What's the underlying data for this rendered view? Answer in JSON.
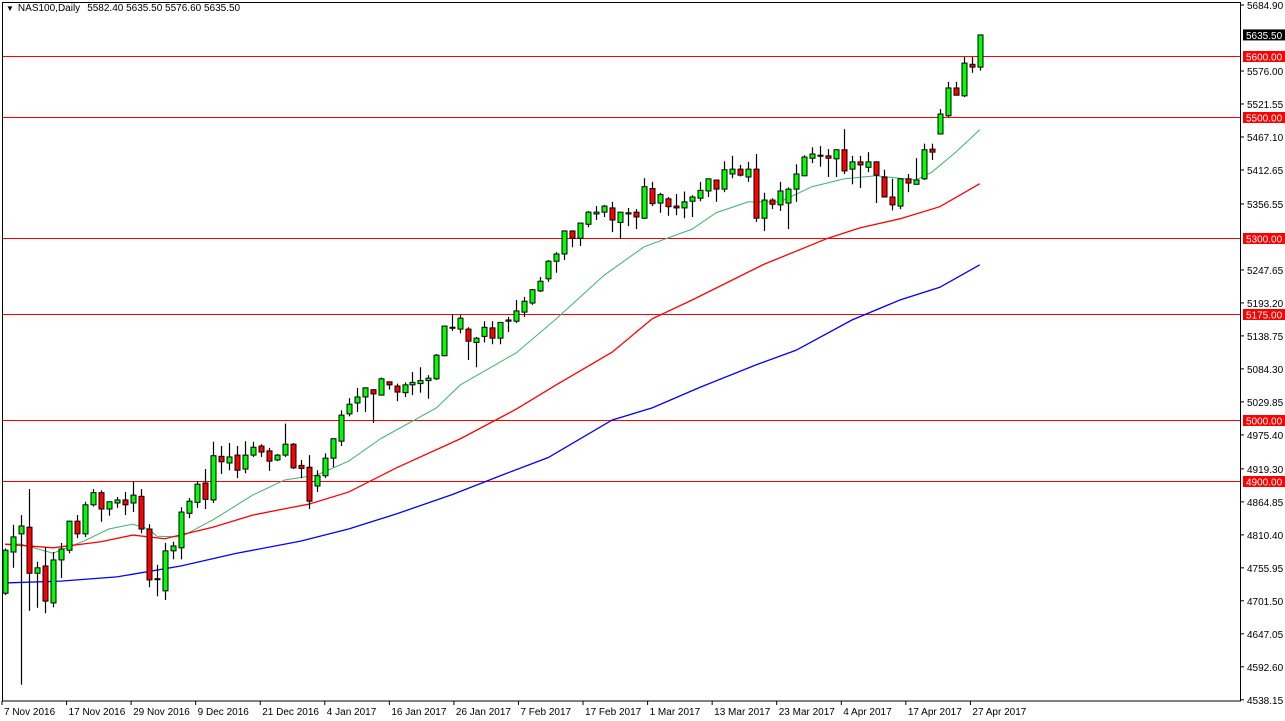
{
  "header": {
    "symbol_timeframe": "NAS100,Daily",
    "ohlc_readout": "5582.40 5635.50 5576.60 5635.50",
    "menu_icon": "triangle-down-icon"
  },
  "colors": {
    "bull": "#00ff00",
    "bear": "#ff0000",
    "outline": "#000000",
    "level_line": "#ff0000",
    "ma_fast": "#3cb371",
    "ma_mid": "#ff0000",
    "ma_slow": "#0000ff",
    "price_tag": "#000000"
  },
  "chart_data": {
    "type": "candlestick",
    "title": "NAS100,Daily",
    "ylim": [
      4538.15,
      5684.9
    ],
    "y_ticks": [
      "5684.90",
      "5576.00",
      "5521.55",
      "5467.10",
      "5412.65",
      "5356.55",
      "5247.65",
      "5193.20",
      "5138.75",
      "5084.30",
      "5029.85",
      "4975.40",
      "4919.30",
      "4864.85",
      "4810.40",
      "4755.95",
      "4701.50",
      "4647.05",
      "4592.60",
      "4538.15"
    ],
    "x_tick_labels": [
      "7 Nov 2016",
      "17 Nov 2016",
      "29 Nov 2016",
      "9 Dec 2016",
      "21 Dec 2016",
      "4 Jan 2017",
      "16 Jan 2017",
      "26 Jan 2017",
      "7 Feb 2017",
      "17 Feb 2017",
      "1 Mar 2017",
      "13 Mar 2017",
      "23 Mar 2017",
      "4 Apr 2017",
      "17 Apr 2017",
      "27 Apr 2017"
    ],
    "x_tick_bar_step": 8,
    "current_price": "5635.50",
    "levels": [
      "5600.00",
      "5500.00",
      "5300.00",
      "5175.00",
      "5000.00",
      "4900.00"
    ],
    "ohlc_fields": [
      "open",
      "high",
      "low",
      "close"
    ],
    "ohlc": [
      [
        4714,
        4788,
        4711,
        4785
      ],
      [
        4782,
        4827,
        4756,
        4807
      ],
      [
        4812,
        4843,
        4563,
        4825
      ],
      [
        4823,
        4886,
        4685,
        4747
      ],
      [
        4747,
        4766,
        4690,
        4756
      ],
      [
        4759,
        4790,
        4681,
        4701
      ],
      [
        4698,
        4782,
        4691,
        4769
      ],
      [
        4769,
        4797,
        4739,
        4787
      ],
      [
        4785,
        4833,
        4780,
        4833
      ],
      [
        4833,
        4843,
        4805,
        4812
      ],
      [
        4812,
        4865,
        4807,
        4860
      ],
      [
        4860,
        4886,
        4857,
        4880
      ],
      [
        4880,
        4884,
        4832,
        4853
      ],
      [
        4853,
        4865,
        4842,
        4865
      ],
      [
        4863,
        4873,
        4855,
        4868
      ],
      [
        4868,
        4881,
        4843,
        4860
      ],
      [
        4863,
        4899,
        4848,
        4876
      ],
      [
        4874,
        4886,
        4813,
        4820
      ],
      [
        4820,
        4828,
        4724,
        4736
      ],
      [
        4737,
        4761,
        4709,
        4738
      ],
      [
        4718,
        4797,
        4703,
        4784
      ],
      [
        4784,
        4799,
        4770,
        4792
      ],
      [
        4789,
        4856,
        4770,
        4848
      ],
      [
        4846,
        4871,
        4838,
        4866
      ],
      [
        4864,
        4899,
        4855,
        4894
      ],
      [
        4896,
        4919,
        4853,
        4869
      ],
      [
        4868,
        4964,
        4863,
        4941
      ],
      [
        4940,
        4957,
        4911,
        4931
      ],
      [
        4929,
        4962,
        4917,
        4939
      ],
      [
        4942,
        4957,
        4904,
        4917
      ],
      [
        4919,
        4965,
        4912,
        4942
      ],
      [
        4942,
        4964,
        4939,
        4955
      ],
      [
        4957,
        4960,
        4939,
        4947
      ],
      [
        4949,
        4954,
        4916,
        4932
      ],
      [
        4934,
        4944,
        4932,
        4942
      ],
      [
        4942,
        4994,
        4939,
        4960
      ],
      [
        4960,
        4962,
        4919,
        4921
      ],
      [
        4925,
        4934,
        4904,
        4920
      ],
      [
        4922,
        4942,
        4853,
        4866
      ],
      [
        4891,
        4917,
        4881,
        4908
      ],
      [
        4908,
        4945,
        4904,
        4937
      ],
      [
        4937,
        4970,
        4922,
        4969
      ],
      [
        4965,
        5016,
        4957,
        5008
      ],
      [
        5010,
        5036,
        5006,
        5026
      ],
      [
        5028,
        5053,
        5013,
        5038
      ],
      [
        5038,
        5054,
        5013,
        5053
      ],
      [
        5050,
        5050,
        4995,
        5043
      ],
      [
        5041,
        5070,
        5041,
        5068
      ],
      [
        5063,
        5063,
        5050,
        5058
      ],
      [
        5056,
        5060,
        5031,
        5046
      ],
      [
        5045,
        5062,
        5038,
        5058
      ],
      [
        5058,
        5079,
        5041,
        5062
      ],
      [
        5060,
        5087,
        5045,
        5065
      ],
      [
        5065,
        5074,
        5035,
        5069
      ],
      [
        5068,
        5109,
        5066,
        5107
      ],
      [
        5106,
        5155,
        5105,
        5155
      ],
      [
        5152,
        5175,
        5147,
        5153
      ],
      [
        5150,
        5173,
        5143,
        5168
      ],
      [
        5150,
        5153,
        5099,
        5130
      ],
      [
        5128,
        5137,
        5087,
        5135
      ],
      [
        5138,
        5163,
        5128,
        5153
      ],
      [
        5152,
        5163,
        5125,
        5135
      ],
      [
        5135,
        5161,
        5125,
        5161
      ],
      [
        5163,
        5170,
        5145,
        5165
      ],
      [
        5163,
        5198,
        5160,
        5180
      ],
      [
        5178,
        5203,
        5170,
        5196
      ],
      [
        5193,
        5216,
        5190,
        5215
      ],
      [
        5213,
        5236,
        5211,
        5229
      ],
      [
        5233,
        5264,
        5228,
        5262
      ],
      [
        5262,
        5277,
        5243,
        5274
      ],
      [
        5274,
        5313,
        5264,
        5312
      ],
      [
        5312,
        5313,
        5285,
        5300
      ],
      [
        5300,
        5325,
        5287,
        5325
      ],
      [
        5323,
        5345,
        5318,
        5343
      ],
      [
        5340,
        5353,
        5330,
        5343
      ],
      [
        5343,
        5355,
        5335,
        5353
      ],
      [
        5350,
        5360,
        5310,
        5330
      ],
      [
        5326,
        5343,
        5299,
        5343
      ],
      [
        5340,
        5350,
        5320,
        5342
      ],
      [
        5343,
        5348,
        5315,
        5335
      ],
      [
        5333,
        5399,
        5332,
        5385
      ],
      [
        5382,
        5393,
        5353,
        5357
      ],
      [
        5358,
        5375,
        5342,
        5372
      ],
      [
        5365,
        5368,
        5337,
        5352
      ],
      [
        5353,
        5373,
        5338,
        5350
      ],
      [
        5350,
        5377,
        5333,
        5360
      ],
      [
        5361,
        5371,
        5335,
        5368
      ],
      [
        5366,
        5393,
        5361,
        5379
      ],
      [
        5378,
        5398,
        5368,
        5398
      ],
      [
        5396,
        5396,
        5360,
        5381
      ],
      [
        5381,
        5427,
        5376,
        5413
      ],
      [
        5406,
        5436,
        5399,
        5414
      ],
      [
        5414,
        5421,
        5402,
        5404
      ],
      [
        5401,
        5426,
        5393,
        5414
      ],
      [
        5414,
        5439,
        5327,
        5333
      ],
      [
        5333,
        5375,
        5312,
        5363
      ],
      [
        5363,
        5366,
        5348,
        5356
      ],
      [
        5355,
        5393,
        5345,
        5378
      ],
      [
        5358,
        5384,
        5315,
        5381
      ],
      [
        5381,
        5422,
        5360,
        5406
      ],
      [
        5403,
        5437,
        5403,
        5434
      ],
      [
        5432,
        5450,
        5424,
        5439
      ],
      [
        5436,
        5452,
        5418,
        5437
      ],
      [
        5436,
        5447,
        5401,
        5432
      ],
      [
        5431,
        5446,
        5401,
        5446
      ],
      [
        5446,
        5480,
        5406,
        5411
      ],
      [
        5414,
        5436,
        5389,
        5426
      ],
      [
        5426,
        5436,
        5383,
        5421
      ],
      [
        5417,
        5442,
        5409,
        5426
      ],
      [
        5426,
        5427,
        5358,
        5404
      ],
      [
        5401,
        5413,
        5368,
        5368
      ],
      [
        5368,
        5398,
        5346,
        5355
      ],
      [
        5353,
        5398,
        5348,
        5398
      ],
      [
        5398,
        5406,
        5376,
        5391
      ],
      [
        5389,
        5432,
        5389,
        5396
      ],
      [
        5398,
        5456,
        5396,
        5446
      ],
      [
        5447,
        5456,
        5429,
        5442
      ],
      [
        5472,
        5513,
        5472,
        5505
      ],
      [
        5502,
        5558,
        5500,
        5548
      ],
      [
        5548,
        5558,
        5536,
        5536
      ],
      [
        5535,
        5599,
        5533,
        5589
      ],
      [
        5587,
        5599,
        5573,
        5582.4
      ],
      [
        5582.4,
        5635.5,
        5576.6,
        5635.5
      ]
    ],
    "moving_averages": [
      {
        "name": "ma-fast",
        "color": "#3cb371",
        "points": [
          [
            0,
            4795
          ],
          [
            2,
            4795
          ],
          [
            6,
            4780
          ],
          [
            10,
            4801
          ],
          [
            13,
            4820
          ],
          [
            16,
            4828
          ],
          [
            18,
            4820
          ],
          [
            19,
            4808
          ],
          [
            22,
            4807
          ],
          [
            26,
            4835
          ],
          [
            31,
            4876
          ],
          [
            35,
            4901
          ],
          [
            39,
            4909
          ],
          [
            43,
            4932
          ],
          [
            47,
            4969
          ],
          [
            54,
            5020
          ],
          [
            57,
            5058
          ],
          [
            64,
            5111
          ],
          [
            69,
            5167
          ],
          [
            75,
            5239
          ],
          [
            80,
            5286
          ],
          [
            86,
            5315
          ],
          [
            89,
            5342
          ],
          [
            93,
            5360
          ],
          [
            97,
            5360
          ],
          [
            101,
            5385
          ],
          [
            105,
            5398
          ],
          [
            109,
            5403
          ],
          [
            114,
            5396
          ],
          [
            116,
            5409
          ],
          [
            119,
            5442
          ],
          [
            122,
            5479
          ]
        ]
      },
      {
        "name": "ma-mid",
        "color": "#ff0000",
        "points": [
          [
            0,
            4795
          ],
          [
            6,
            4789
          ],
          [
            12,
            4799
          ],
          [
            16,
            4810
          ],
          [
            20,
            4804
          ],
          [
            26,
            4823
          ],
          [
            31,
            4843
          ],
          [
            36,
            4856
          ],
          [
            38,
            4861
          ],
          [
            43,
            4881
          ],
          [
            49,
            4921
          ],
          [
            57,
            4969
          ],
          [
            64,
            5018
          ],
          [
            69,
            5058
          ],
          [
            76,
            5112
          ],
          [
            81,
            5167
          ],
          [
            86,
            5198
          ],
          [
            95,
            5257
          ],
          [
            103,
            5300
          ],
          [
            107,
            5317
          ],
          [
            112,
            5332
          ],
          [
            117,
            5352
          ],
          [
            122,
            5390
          ]
        ]
      },
      {
        "name": "ma-slow",
        "color": "#0000ff",
        "points": [
          [
            0,
            4731
          ],
          [
            7,
            4734
          ],
          [
            14,
            4741
          ],
          [
            22,
            4759
          ],
          [
            29,
            4780
          ],
          [
            37,
            4800
          ],
          [
            43,
            4820
          ],
          [
            49,
            4845
          ],
          [
            56,
            4877
          ],
          [
            62,
            4908
          ],
          [
            68,
            4938
          ],
          [
            76,
            5000
          ],
          [
            81,
            5020
          ],
          [
            87,
            5054
          ],
          [
            94,
            5091
          ],
          [
            99,
            5115
          ],
          [
            106,
            5165
          ],
          [
            112,
            5198
          ],
          [
            117,
            5219
          ],
          [
            122,
            5256
          ]
        ]
      }
    ]
  }
}
